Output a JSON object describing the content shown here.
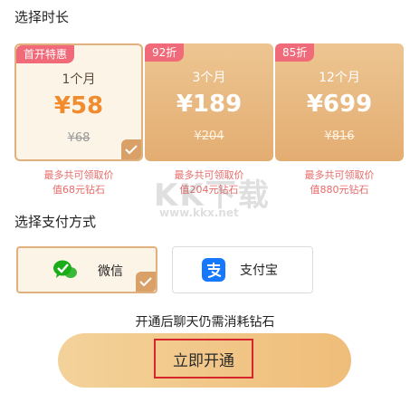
{
  "duration_title": "选择时长",
  "plans": [
    {
      "badge": "首开特惠",
      "months": "1个月",
      "price": "¥58",
      "original": "¥68",
      "note_line1": "最多共可领取价",
      "note_line2": "值68元钻石",
      "selected": true
    },
    {
      "badge": "92折",
      "months": "3个月",
      "price": "¥189",
      "original": "¥204",
      "note_line1": "最多共可领取价",
      "note_line2": "值204元钻石",
      "selected": false
    },
    {
      "badge": "85折",
      "months": "12个月",
      "price": "¥699",
      "original": "¥816",
      "note_line1": "最多共可领取价",
      "note_line2": "值880元钻石",
      "selected": false
    }
  ],
  "watermark": {
    "logo": "KK下载",
    "url": "www.kkx.net"
  },
  "payment_title": "选择支付方式",
  "payments": [
    {
      "label": "微信",
      "icon": "wechat-icon",
      "selected": true
    },
    {
      "label": "支付宝",
      "icon": "alipay-icon",
      "selected": false
    }
  ],
  "notice": "开通后聊天仍需消耗钻石",
  "cta_label": "立即开通",
  "colors": {
    "accent_orange": "#f08c2e",
    "gold": "#e3ad72",
    "badge_pink": "#f06a7a",
    "note_red": "#e86a6a",
    "highlight_red": "#d6262b",
    "wechat_green": "#1aad19",
    "alipay_blue": "#1677ff"
  }
}
